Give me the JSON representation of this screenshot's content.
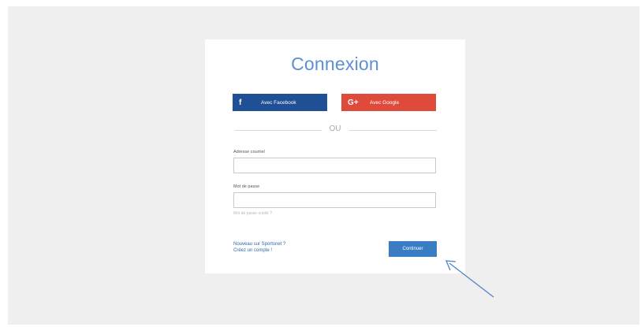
{
  "login": {
    "title": "Connexion",
    "facebook_label": "Avec Facebook",
    "google_label": "Avec Google",
    "facebook_icon": "f",
    "google_icon": "G+",
    "or_label": "OU",
    "email_label": "Adresse courriel",
    "email_value": "",
    "password_label": "Mot de passe",
    "password_value": "",
    "forgot_password": "Mot de passe oublié ?",
    "signup_line1": "Nouveau sur Sportsnet ?",
    "signup_line2": "Créez un compte !",
    "continue_label": "Continuer"
  },
  "colors": {
    "facebook": "#1f4f95",
    "google": "#df4b3b",
    "accent": "#3b7dc4",
    "title": "#5b8fd0",
    "annotation_arrow": "#4a86c8"
  }
}
